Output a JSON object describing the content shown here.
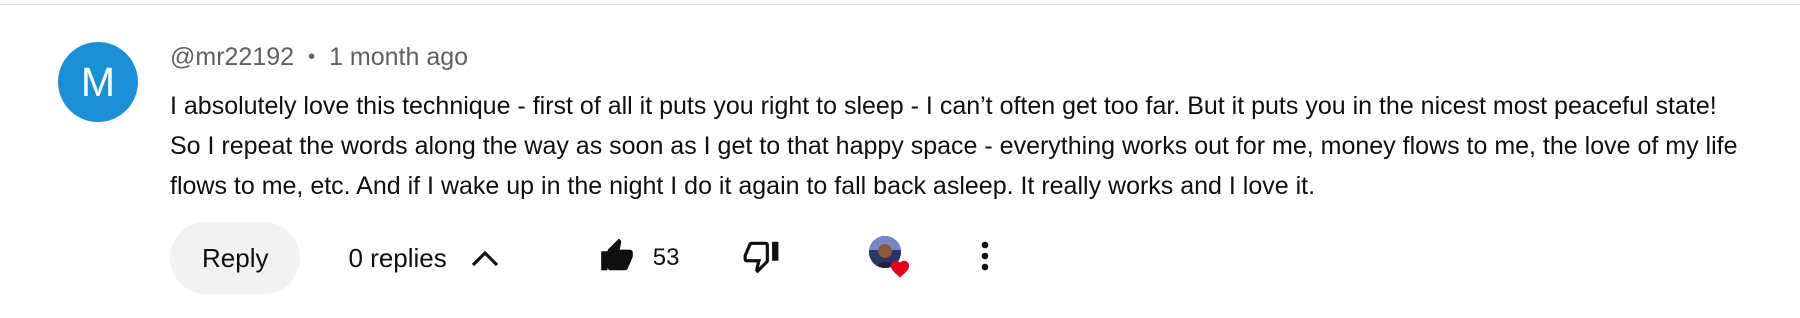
{
  "comment": {
    "avatar_letter": "M",
    "avatar_color": "#1a8fd6",
    "author": "@mr22192",
    "separator": "•",
    "timestamp": "1 month ago",
    "text": "I absolutely love this technique - first of all it puts you right to sleep - I can’t often get too far. But it puts you in the nicest most peaceful state! So I repeat the words along the way as soon as I get to that happy space - everything works out for me, money flows to me, the love of my life flows to me, etc. And if I wake up in the night I do it again to fall back asleep. It really works and I love it."
  },
  "actions": {
    "reply_label": "Reply",
    "replies_label": "0 replies",
    "replies_icon": "chevron-up-icon",
    "like_icon": "thumbs-up-filled-icon",
    "like_count": "53",
    "dislike_icon": "thumbs-down-icon",
    "creator_heart_icon": "heart-icon",
    "heart_color": "#e3001b",
    "more_icon": "more-vertical-icon"
  }
}
